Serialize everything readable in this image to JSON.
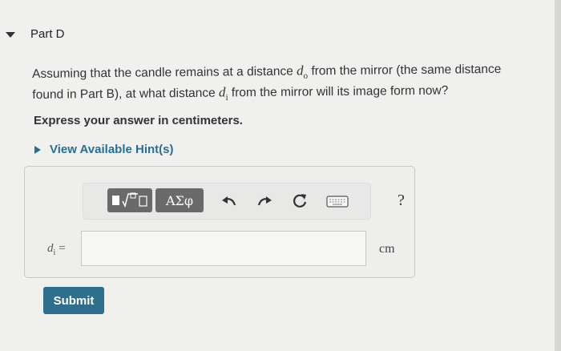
{
  "part": {
    "title": "Part D",
    "toggle_icon": "caret-down-icon"
  },
  "question": {
    "text_1": "Assuming that the candle remains at a distance ",
    "var_do": "d",
    "var_do_sub": "o",
    "text_2": " from the mirror (the same distance found in Part B), at what distance ",
    "var_di": "d",
    "var_di_sub": "i",
    "text_3": " from the mirror will its image form now?"
  },
  "instruction": "Express your answer in centimeters.",
  "hint": {
    "label": "View Available Hint(s)",
    "icon": "triangle-right-icon"
  },
  "toolbar": {
    "greek_label": "ΑΣφ",
    "math_templates_icon": "math-templates-icon",
    "undo_icon": "undo-icon",
    "redo_icon": "redo-icon",
    "reset_icon": "reset-icon",
    "keyboard_icon": "keyboard-icon",
    "help_label": "?"
  },
  "answer": {
    "var": "d",
    "var_sub": "i",
    "equals": "=",
    "value": "",
    "unit": "cm"
  },
  "submit_label": "Submit",
  "colors": {
    "link": "#2a6e95",
    "submit_bg": "#2f6f8e",
    "toolbar_button": "#6a6a6a"
  }
}
